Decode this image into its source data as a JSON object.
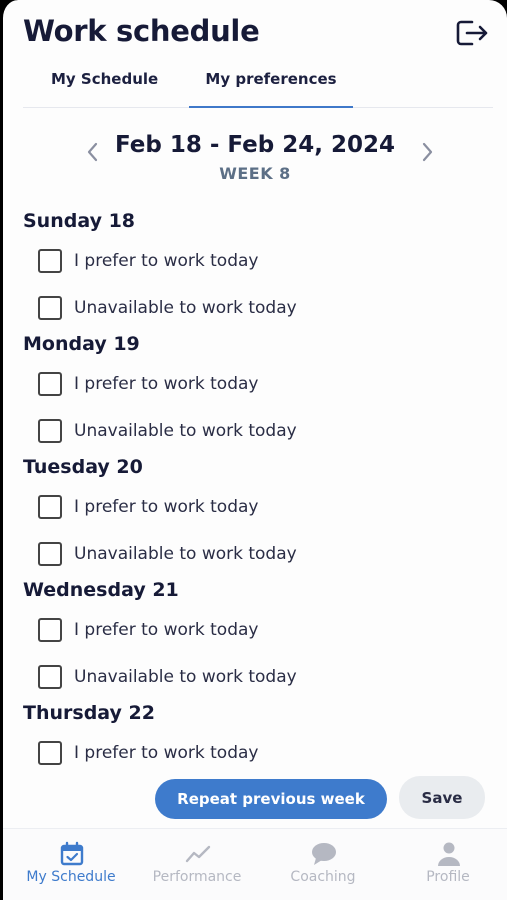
{
  "header": {
    "title": "Work schedule",
    "logout_icon": "logout-icon"
  },
  "tabs": [
    {
      "label": "My Schedule",
      "active": false
    },
    {
      "label": "My preferences",
      "active": true
    }
  ],
  "week": {
    "range": "Feb 18 - Feb 24, 2024",
    "label": "WEEK 8"
  },
  "days": [
    {
      "name": "Sunday 18",
      "options": [
        "I prefer to work today",
        "Unavailable to work today"
      ]
    },
    {
      "name": "Monday 19",
      "options": [
        "I prefer to work today",
        "Unavailable to work today"
      ]
    },
    {
      "name": "Tuesday 20",
      "options": [
        "I prefer to work today",
        "Unavailable to work today"
      ]
    },
    {
      "name": "Wednesday 21",
      "options": [
        "I prefer to work today",
        "Unavailable to work today"
      ]
    },
    {
      "name": "Thursday 22",
      "options": [
        "I prefer to work today"
      ]
    }
  ],
  "actions": {
    "repeat_label": "Repeat previous week",
    "save_label": "Save"
  },
  "nav": [
    {
      "label": "My Schedule",
      "icon": "calendar-check-icon",
      "active": true
    },
    {
      "label": "Performance",
      "icon": "trend-line-icon",
      "active": false
    },
    {
      "label": "Coaching",
      "icon": "chat-bubble-icon",
      "active": false
    },
    {
      "label": "Profile",
      "icon": "person-icon",
      "active": false
    }
  ],
  "colors": {
    "accent": "#3e7bcc",
    "text": "#161a37",
    "muted": "#b5b8c2"
  }
}
